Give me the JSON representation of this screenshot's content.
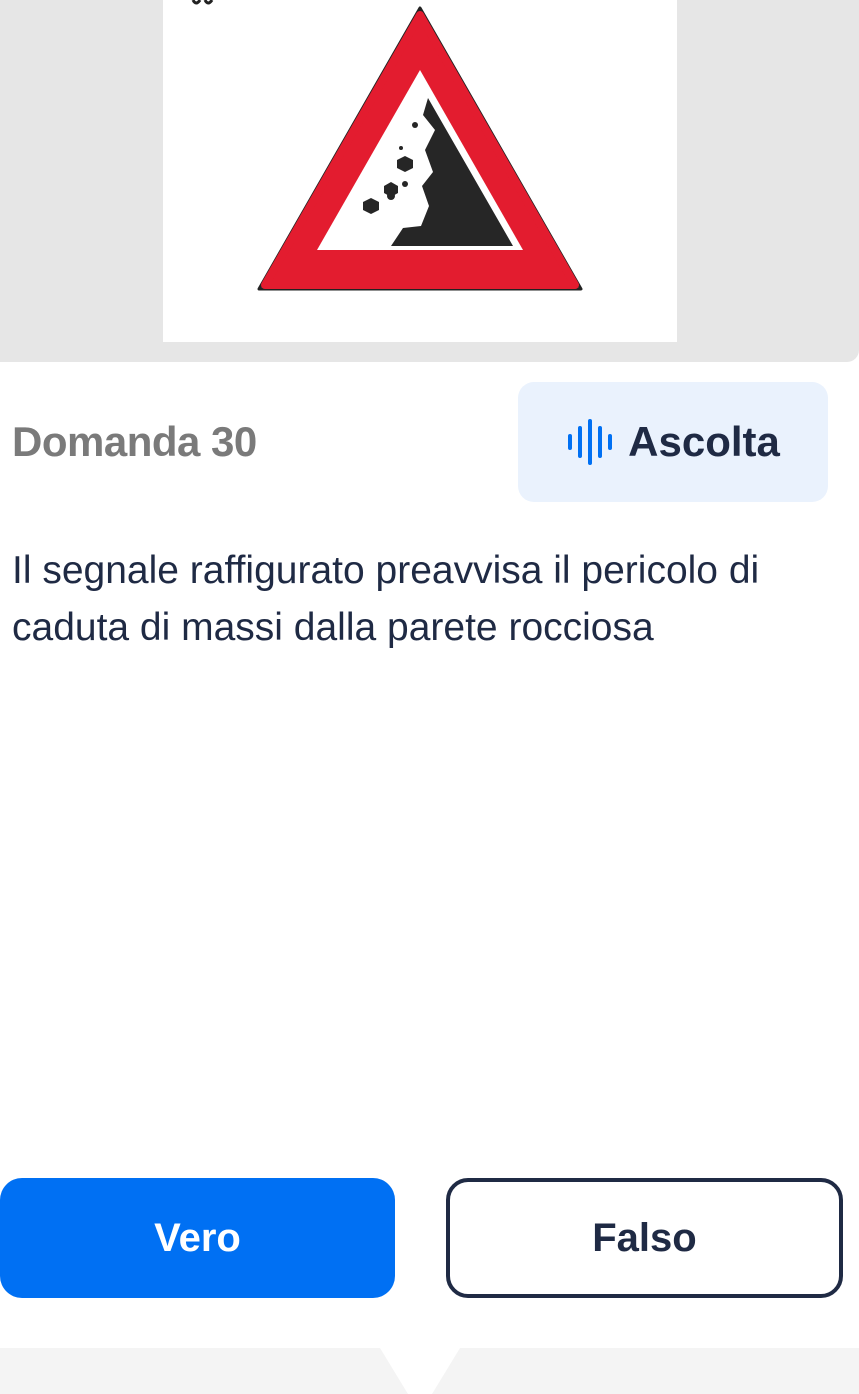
{
  "sign_image": {
    "icon": "falling-rocks-warning-sign",
    "colors": {
      "border": "#e31c2f",
      "symbol": "#262626",
      "background": "#ffffff"
    }
  },
  "question": {
    "number_label": "Domanda 30",
    "text": "Il segnale raffigurato preavvisa il pericolo di caduta di massi dalla parete rocciosa"
  },
  "listen_button": {
    "label": "Ascolta",
    "icon": "audio-waveform-icon",
    "color": "#0070f3"
  },
  "answers": {
    "true_label": "Vero",
    "false_label": "Falso"
  },
  "colors": {
    "primary": "#0070f3",
    "text": "#1f2a44",
    "muted": "#7a7a7a",
    "listen_bg": "#eaf2fd",
    "panel": "#e6e6e6"
  }
}
